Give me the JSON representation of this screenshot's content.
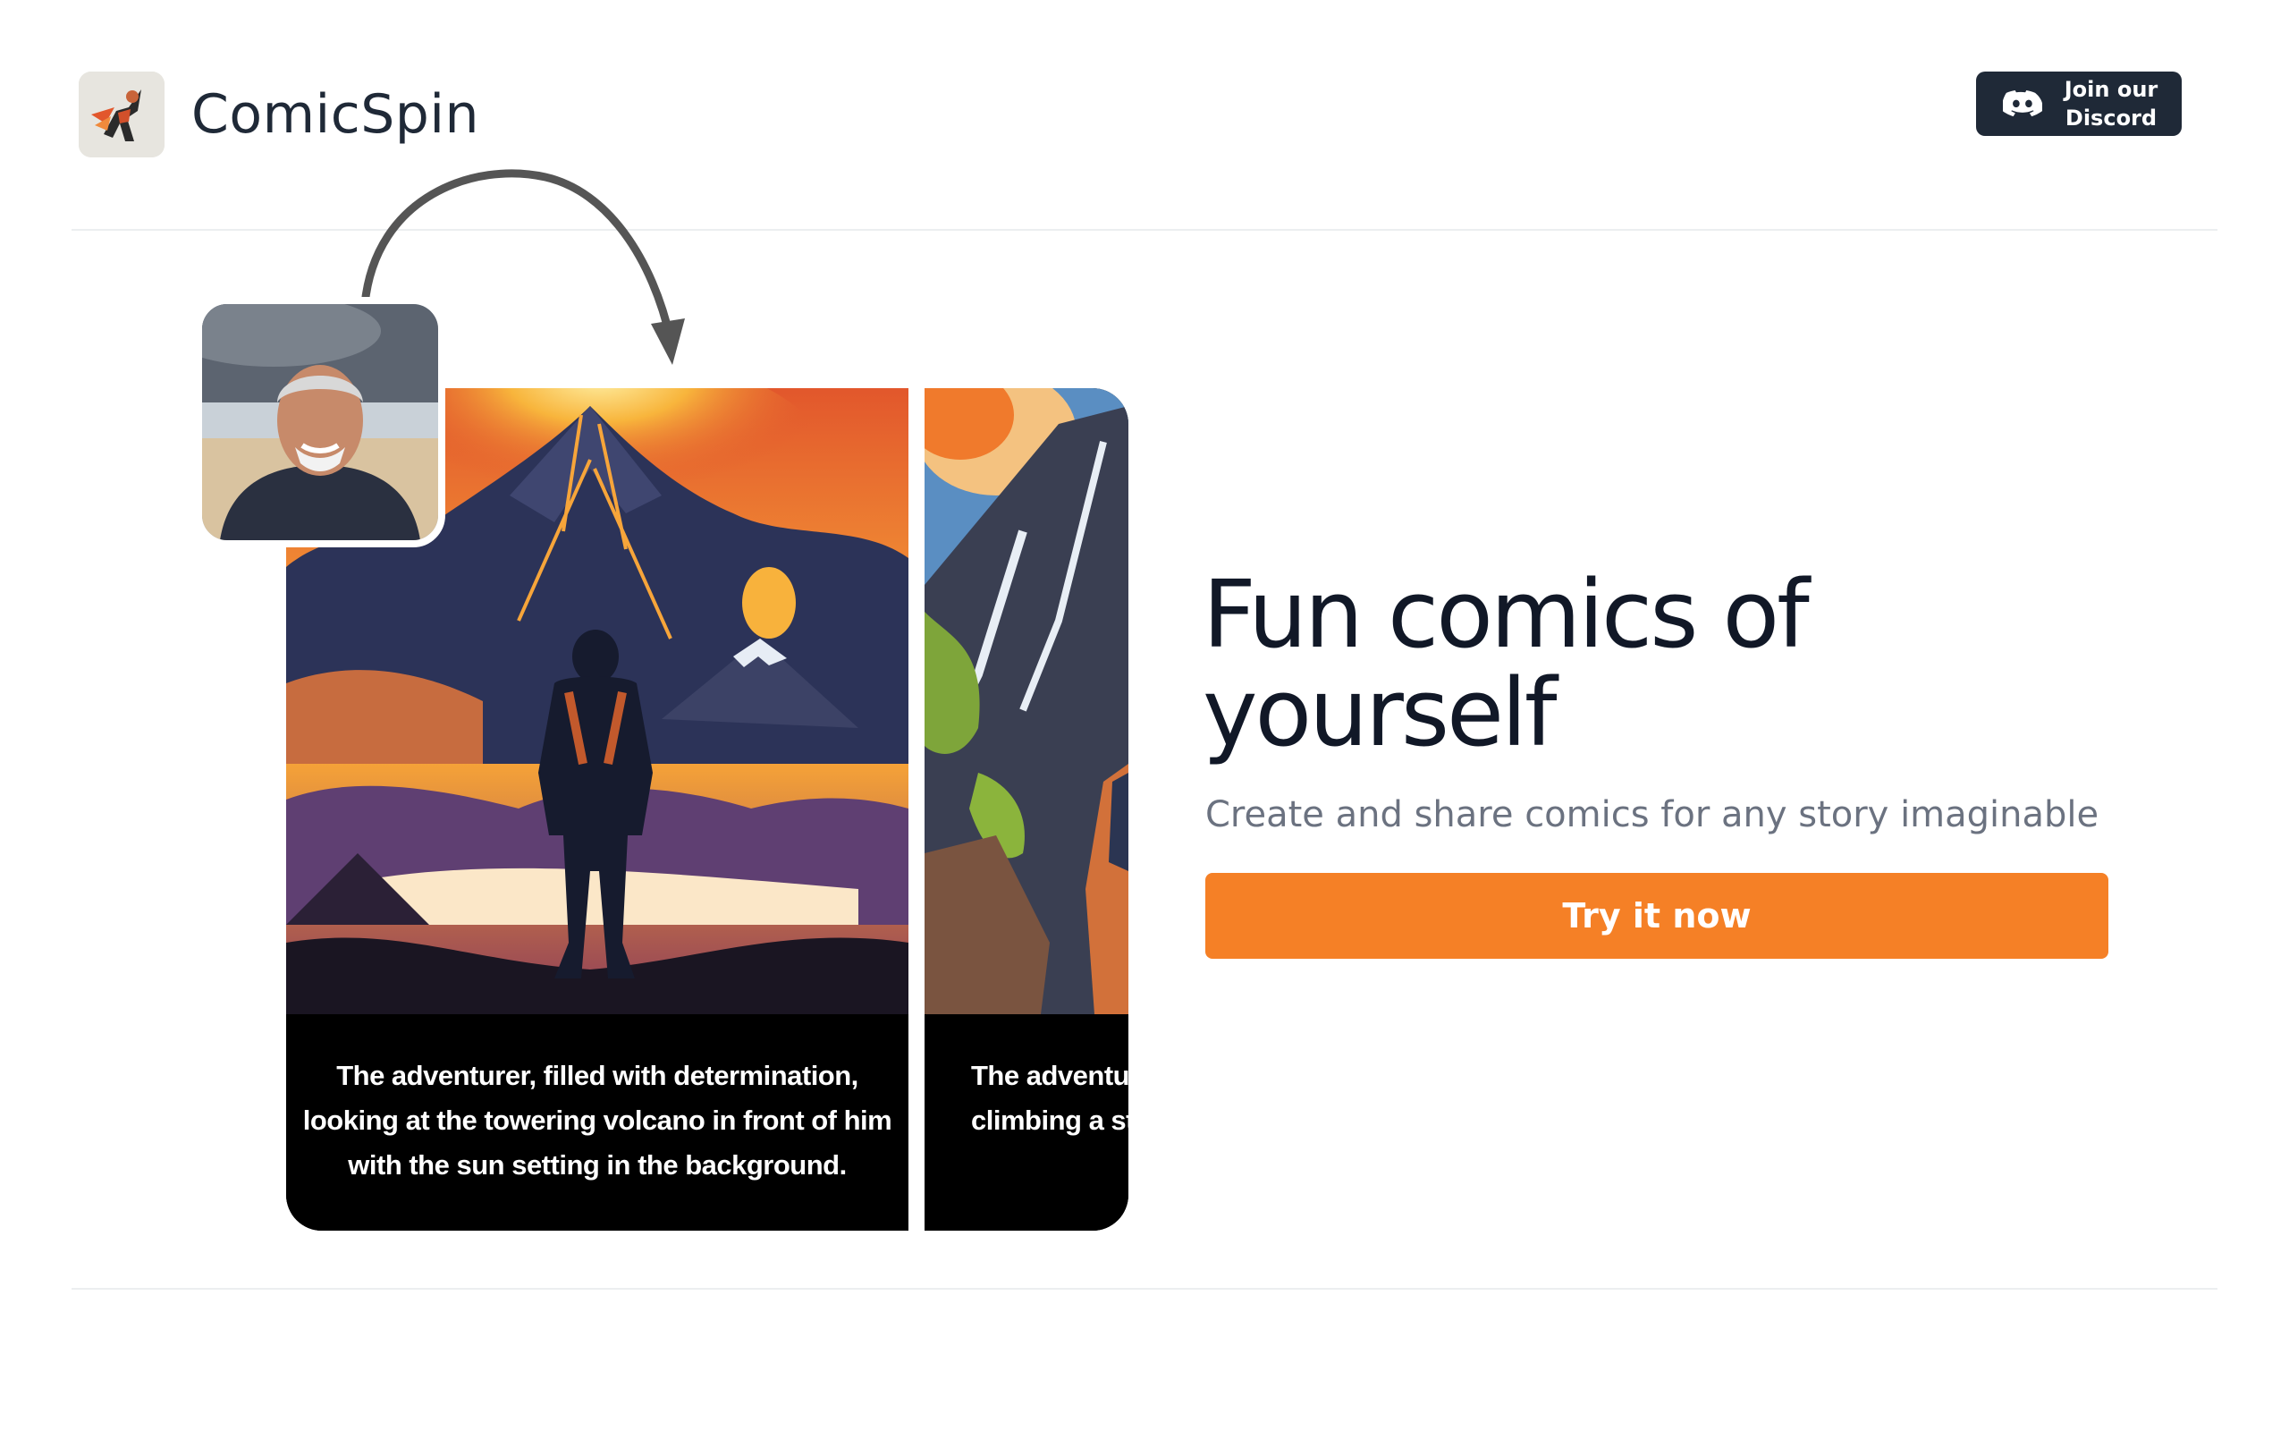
{
  "app": {
    "name": "ComicSpin"
  },
  "header": {
    "discord_label": "Join our Discord",
    "discord_line1": "Join our",
    "discord_line2": "Discord"
  },
  "panels": [
    {
      "caption": "The adventurer, filled with determination, looking at the towering volcano in front of him with the sun setting in the background.",
      "lines": [
        "The adventurer, filled with determination,",
        "looking at the towering volcano in front of him",
        "with the sun setting in the background."
      ]
    },
    {
      "lines": [
        "The adventu",
        "climbing a ste"
      ]
    }
  ],
  "hero": {
    "title_line1": "Fun comics of",
    "title_line2": "yourself",
    "subtitle": "Create and share comics for any story imaginable",
    "cta_label": "Try it now"
  },
  "colors": {
    "accent": "#f58026",
    "dark": "#1f2937",
    "muted": "#6b7280"
  }
}
